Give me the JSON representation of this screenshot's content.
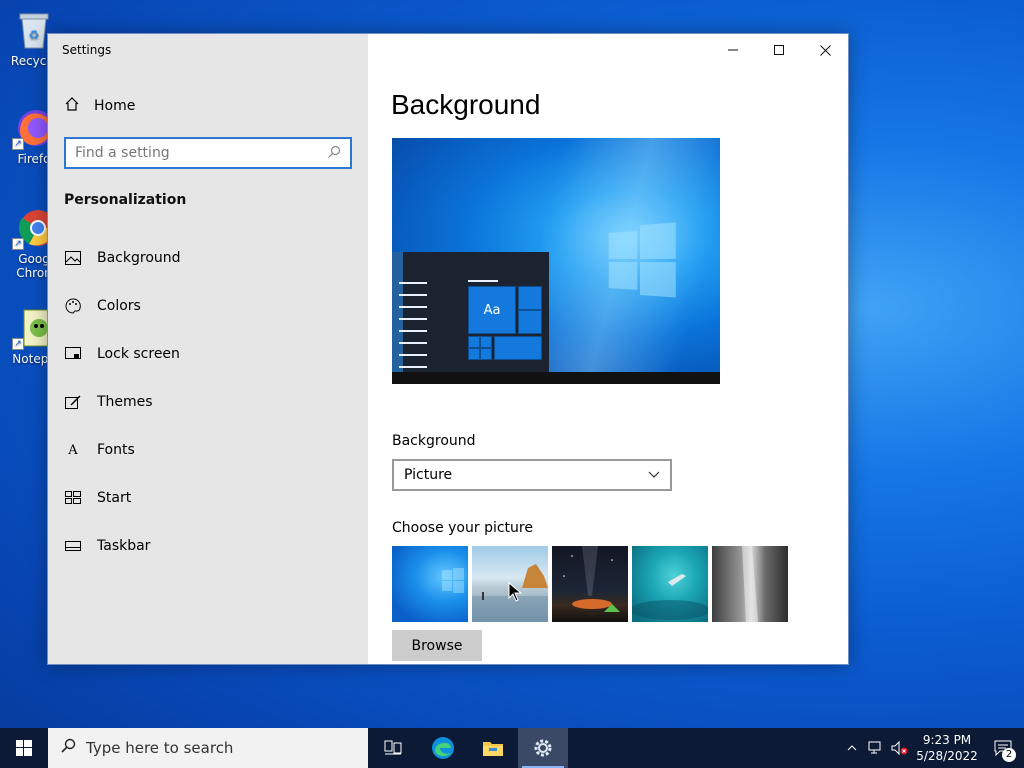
{
  "desktop": {
    "icons": [
      {
        "label": "Recycle",
        "icon": "recycle-bin-icon"
      },
      {
        "label": "Firefo",
        "icon": "firefox-icon"
      },
      {
        "label": "Goog\nChron",
        "icon": "chrome-icon"
      },
      {
        "label": "Notepa",
        "icon": "notepad-icon"
      }
    ]
  },
  "window": {
    "title": "Settings",
    "controls": [
      "minimize",
      "maximize",
      "close"
    ]
  },
  "sidebar": {
    "home_label": "Home",
    "search_placeholder": "Find a setting",
    "section_title": "Personalization",
    "items": [
      {
        "label": "Background",
        "icon": "picture-icon"
      },
      {
        "label": "Colors",
        "icon": "palette-icon"
      },
      {
        "label": "Lock screen",
        "icon": "lock-screen-icon"
      },
      {
        "label": "Themes",
        "icon": "themes-icon"
      },
      {
        "label": "Fonts",
        "icon": "fonts-icon"
      },
      {
        "label": "Start",
        "icon": "start-icon"
      },
      {
        "label": "Taskbar",
        "icon": "taskbar-icon"
      }
    ]
  },
  "main": {
    "title": "Background",
    "preview_tile_text": "Aa",
    "background_label": "Background",
    "background_value": "Picture",
    "choose_label": "Choose your picture",
    "browse_label": "Browse"
  },
  "taskbar": {
    "search_placeholder": "Type here to search",
    "time": "9:23 PM",
    "date": "5/28/2022",
    "notification_count": "2"
  },
  "colors": {
    "accent": "#0078d7",
    "sidebar_bg": "#e6e6e6",
    "taskbar_bg": "#0c1a36"
  }
}
